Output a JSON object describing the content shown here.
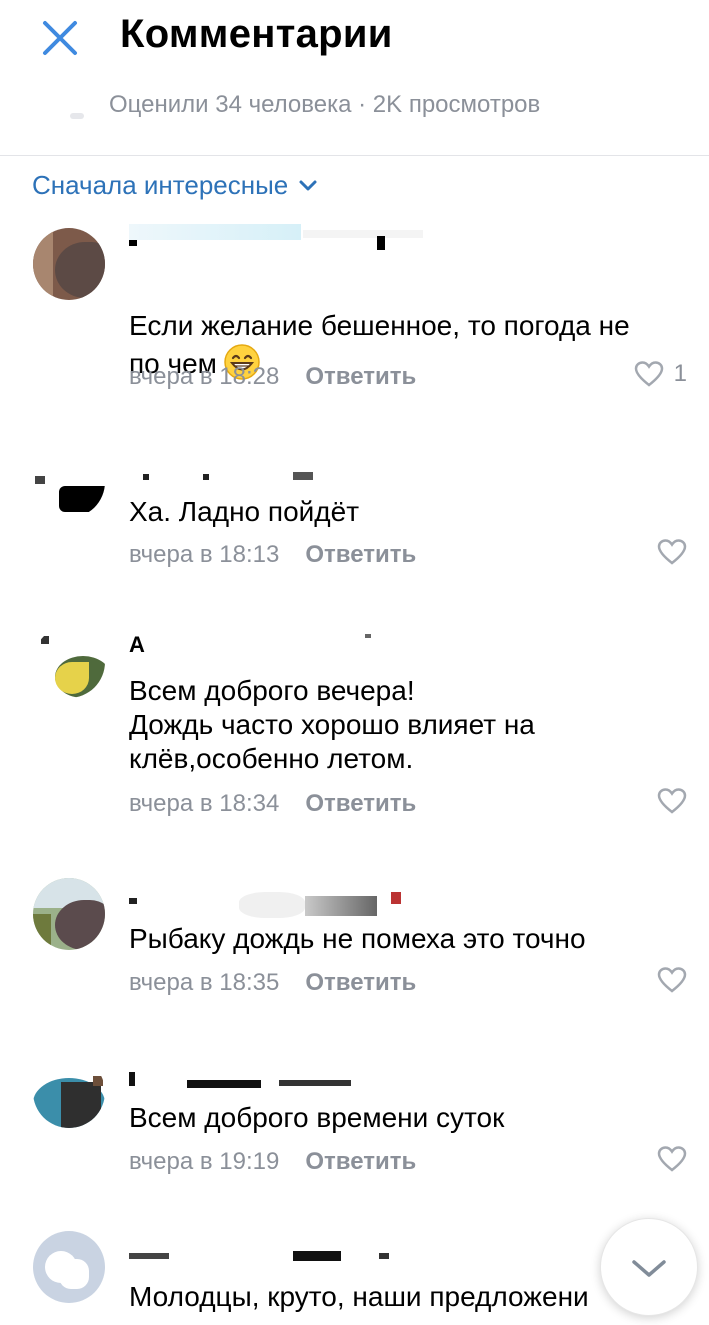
{
  "header": {
    "title": "Комментарии",
    "stats": "Оценили 34 человека · 2K просмотров"
  },
  "sort": {
    "label": "Сначала интересные"
  },
  "comments": [
    {
      "text": "Если желание бешенное, то погода не\nпо чем",
      "time": "вчера в 18:28",
      "reply": "Ответить",
      "likes": "1"
    },
    {
      "text": "Ха. Ладно пойдёт",
      "time": "вчера в 18:13",
      "reply": "Ответить",
      "likes": ""
    },
    {
      "author_initial": "А",
      "text": "Всем доброго вечера!\nДождь часто хорошо влияет на\nклёв,особенно летом.",
      "time": "вчера в 18:34",
      "reply": "Ответить",
      "likes": ""
    },
    {
      "text": "Рыбаку дождь не помеха это точно",
      "time": "вчера в 18:35",
      "reply": "Ответить",
      "likes": ""
    },
    {
      "text": "Всем доброго времени суток",
      "time": "вчера в 19:19",
      "reply": "Ответить",
      "likes": ""
    },
    {
      "text": "Молодцы, круто, наши предложени",
      "time": "",
      "reply": "",
      "likes": ""
    }
  ],
  "colors": {
    "accent": "#2d72b8",
    "meta_gray": "#8b9099",
    "close_icon": "#3f8ae0"
  },
  "icons": {
    "close": "close-icon",
    "sort_chevron": "chevron-down-icon",
    "like": "heart-icon",
    "scroll_down": "chevron-down-icon"
  }
}
